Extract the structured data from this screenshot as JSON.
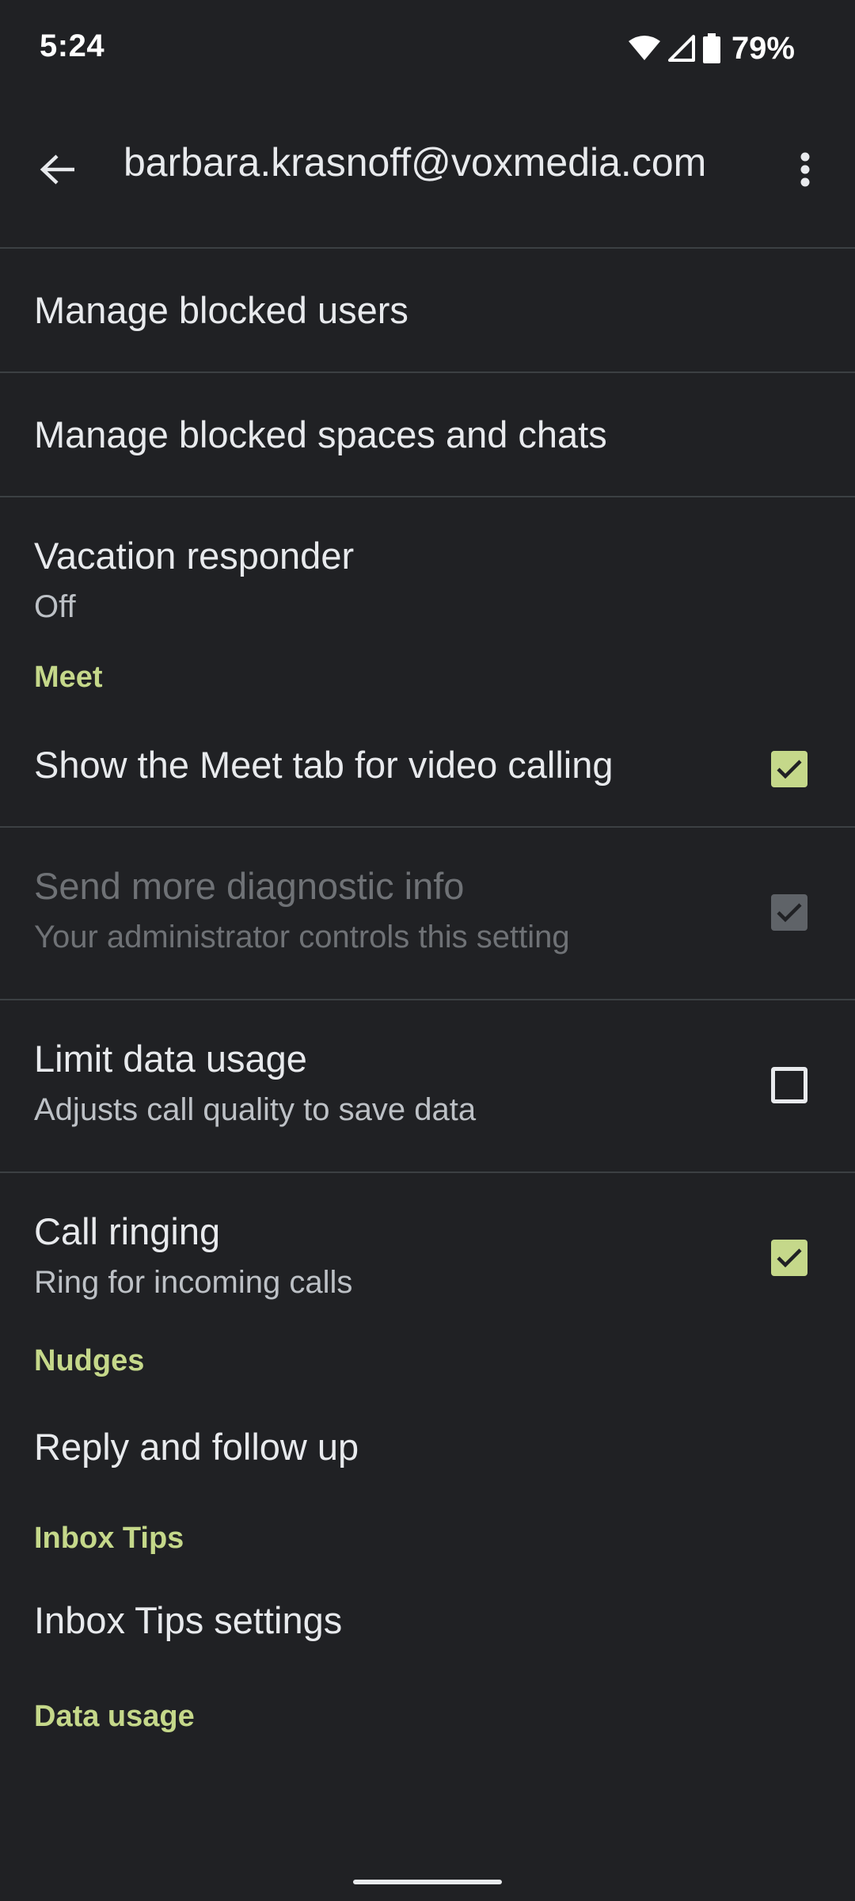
{
  "status_bar": {
    "time": "5:24",
    "battery_percent": "79%",
    "icons": [
      "wifi-icon",
      "cell-signal-icon",
      "battery-icon"
    ]
  },
  "app_bar": {
    "title": "barbara.krasnoff@voxmedia.com",
    "back_icon": "arrow-back-icon",
    "more_icon": "more-vert-icon"
  },
  "settings": {
    "blocked_users": {
      "title": "Manage blocked users"
    },
    "blocked_spaces": {
      "title": "Manage blocked spaces and chats"
    },
    "vacation": {
      "title": "Vacation responder",
      "subtitle": "Off"
    },
    "meet_header": "Meet",
    "meet_tab": {
      "title": "Show the Meet tab for video calling",
      "checked": true
    },
    "diagnostic": {
      "title": "Send more diagnostic info",
      "subtitle": "Your administrator controls this setting",
      "checked": true,
      "disabled": true
    },
    "limit_data": {
      "title": "Limit data usage",
      "subtitle": "Adjusts call quality to save data",
      "checked": false
    },
    "call_ringing": {
      "title": "Call ringing",
      "subtitle": "Ring for incoming calls",
      "checked": true
    },
    "nudges_header": "Nudges",
    "reply_follow": {
      "title": "Reply and follow up"
    },
    "inbox_tips_header": "Inbox Tips",
    "inbox_tips_settings": {
      "title": "Inbox Tips settings"
    },
    "data_usage_header": "Data usage"
  },
  "colors": {
    "background": "#202124",
    "accent": "#c5d88a",
    "divider": "#3c4043",
    "text_primary": "#e8eaed",
    "text_secondary": "#bdc1c6",
    "text_disabled": "#6f7276"
  }
}
